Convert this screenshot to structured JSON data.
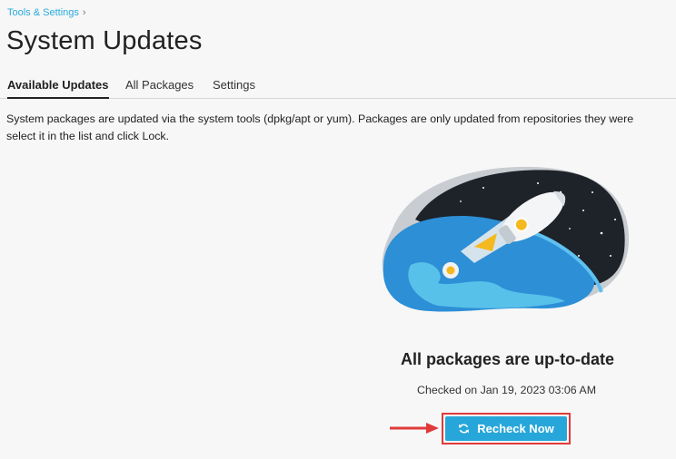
{
  "breadcrumb": {
    "label": "Tools & Settings"
  },
  "page": {
    "title": "System Updates"
  },
  "tabs": [
    {
      "label": "Available Updates",
      "active": true
    },
    {
      "label": "All Packages",
      "active": false
    },
    {
      "label": "Settings",
      "active": false
    }
  ],
  "description": {
    "line1": "System packages are updated via the system tools (dpkg/apt or yum). Packages are only updated from repositories they were",
    "line2": "select it in the list and click Lock."
  },
  "status": {
    "title": "All packages are up-to-date",
    "checked": "Checked on Jan 19, 2023 03:06 AM"
  },
  "button": {
    "label": "Recheck Now",
    "icon": "refresh-icon"
  },
  "colors": {
    "accent": "#27a7d9",
    "highlight": "#e03a3a",
    "link": "#28aade"
  }
}
